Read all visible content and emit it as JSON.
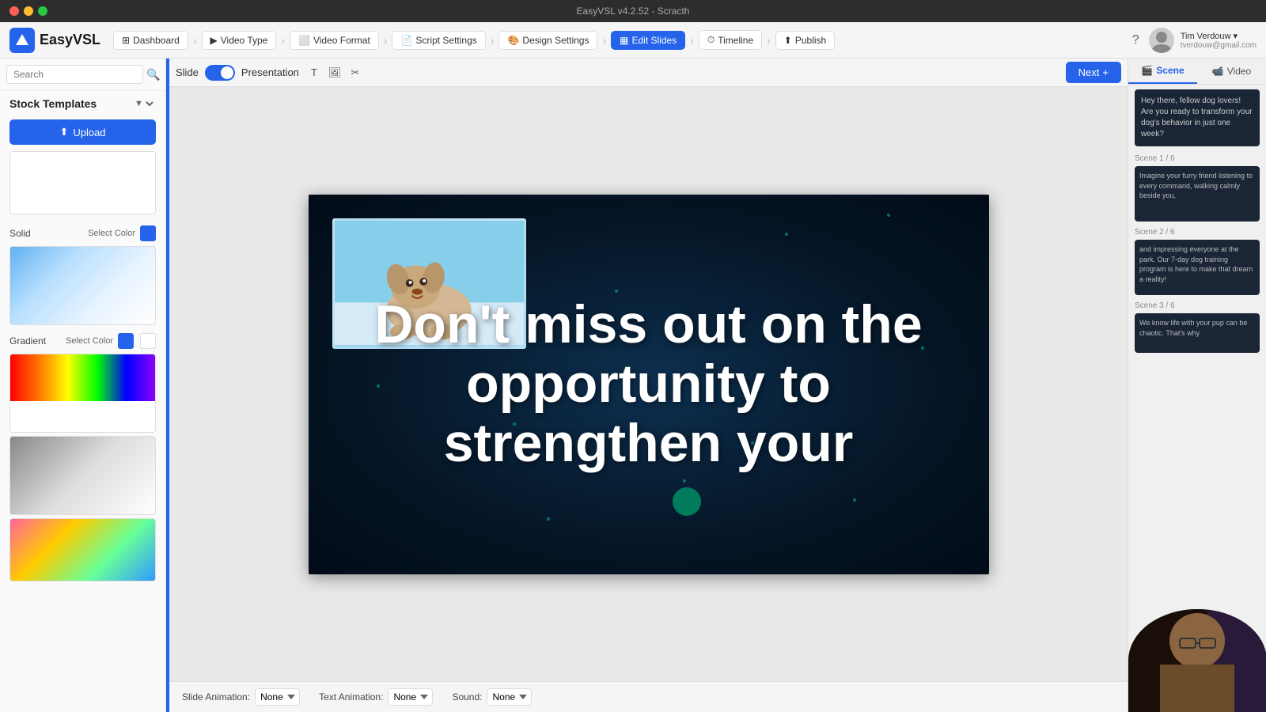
{
  "window": {
    "title": "EasyVSL v4.2.52 - Scracth"
  },
  "nav": {
    "logo": "EasyVSL",
    "items": [
      {
        "label": "Dashboard",
        "icon": "dashboard"
      },
      {
        "label": "Video Type",
        "icon": "video-type"
      },
      {
        "label": "Video Format",
        "icon": "video-format"
      },
      {
        "label": "Script Settings",
        "icon": "script"
      },
      {
        "label": "Design Settings",
        "icon": "design"
      },
      {
        "label": "Edit Slides",
        "icon": "slides",
        "active": true
      },
      {
        "label": "Timeline",
        "icon": "timeline"
      },
      {
        "label": "Publish",
        "icon": "publish"
      }
    ],
    "next_label": "Next",
    "help_icon": "?",
    "user_name": "Tim Verdouw ▾",
    "user_email": "tverdouw@gmail.com"
  },
  "sidebar": {
    "search_placeholder": "Search",
    "section_label": "Stock Templates",
    "upload_label": "Upload",
    "solid_label": "Solid",
    "select_color_label": "Select Color",
    "gradient_label": "Gradient",
    "gradient_select_color": "Select Color"
  },
  "toolbar": {
    "slide_label": "Slide",
    "presentation_label": "Presentation"
  },
  "slide": {
    "main_text": "Don't miss out on the opportunity to strengthen your",
    "animation_slide_label": "Slide Animation:",
    "animation_slide_value": "None",
    "animation_text_label": "Text Animation:",
    "animation_text_value": "None",
    "animation_sound_label": "Sound:",
    "animation_sound_value": "None"
  },
  "right_panel": {
    "tabs": [
      {
        "label": "Scene",
        "active": true
      },
      {
        "label": "Video",
        "active": false
      }
    ],
    "scene_counter": "Scene 1 / 6",
    "scene_label_2": "Scene 2 / 6",
    "scene_label_3": "Scene 3 / 6",
    "scene_preview_1_text": "Hey there, fellow dog lovers! Are you ready to transform your dog's behavior in just one week?",
    "scene_preview_2_text": "Imagine your furry friend listening to every command, walking calmly beside you,",
    "scene_preview_3_text": "and impressing everyone at the park. Our 7-day dog training program is here to make that dream a reality!",
    "scene_preview_4_text": "We know life with your pup can be chaotic. That's why"
  }
}
